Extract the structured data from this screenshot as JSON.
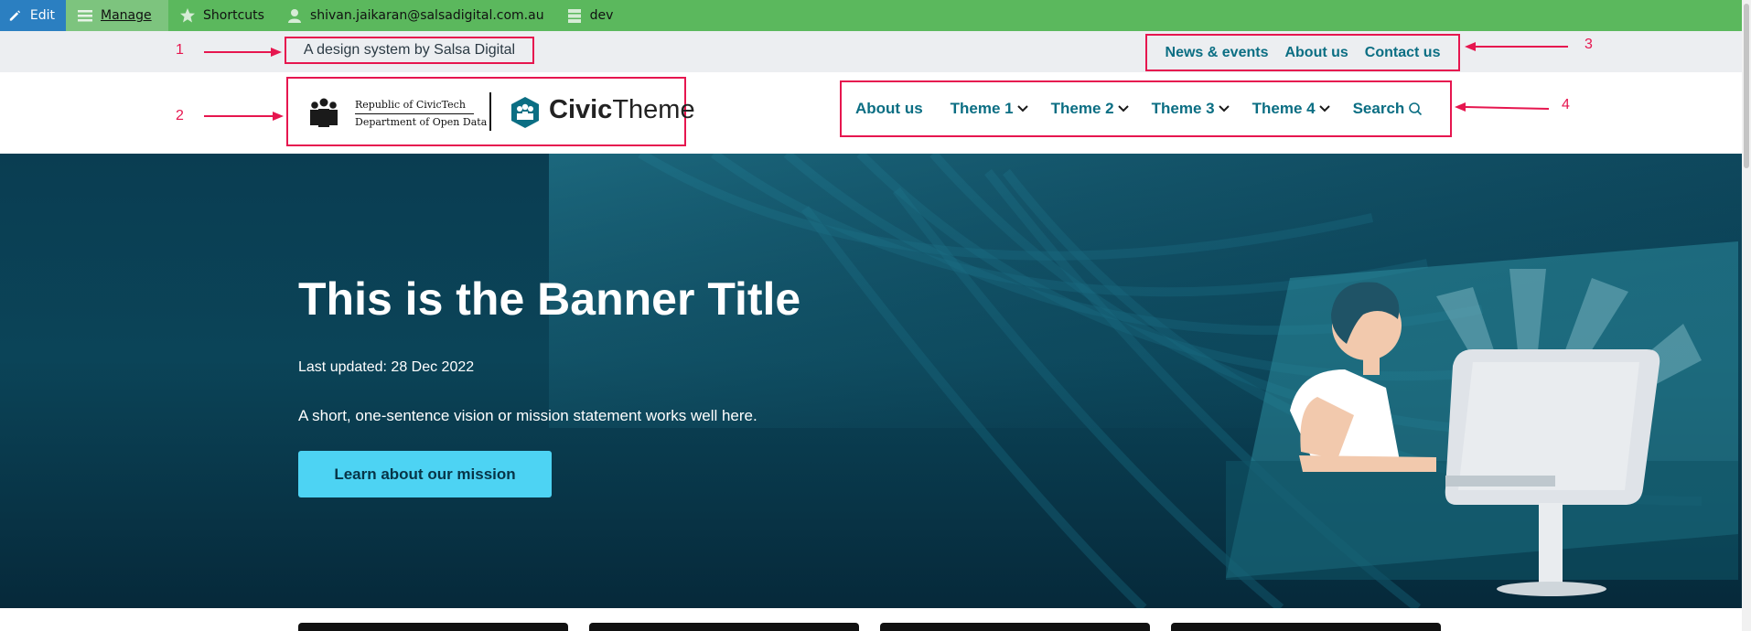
{
  "admin_bar": {
    "edit": "Edit",
    "manage": "Manage",
    "shortcuts": "Shortcuts",
    "user": "shivan.jaikaran@salsadigital.com.au",
    "env": "dev"
  },
  "slogan": "A design system by Salsa Digital",
  "secondary_nav": [
    "News & events",
    "About us",
    "Contact us"
  ],
  "logo": {
    "org_line1": "Republic of CivicTech",
    "org_line2": "Department of Open Data",
    "brand_bold": "Civic",
    "brand_light": "Theme"
  },
  "main_nav": {
    "items": [
      "About us",
      "Theme 1",
      "Theme 2",
      "Theme 3",
      "Theme 4"
    ],
    "search": "Search"
  },
  "annotations": [
    "1",
    "2",
    "3",
    "4"
  ],
  "banner": {
    "title": "This is the Banner Title",
    "date": "Last updated: 28 Dec 2022",
    "summary": "A short, one-sentence vision or mission statement works well here.",
    "button": "Learn about our mission"
  },
  "colors": {
    "accent": "#0b6e83",
    "annotation": "#e6164f",
    "admin_bar": "#5bb85d",
    "banner_bg": "#0a3d52",
    "button": "#4dd3f3"
  }
}
